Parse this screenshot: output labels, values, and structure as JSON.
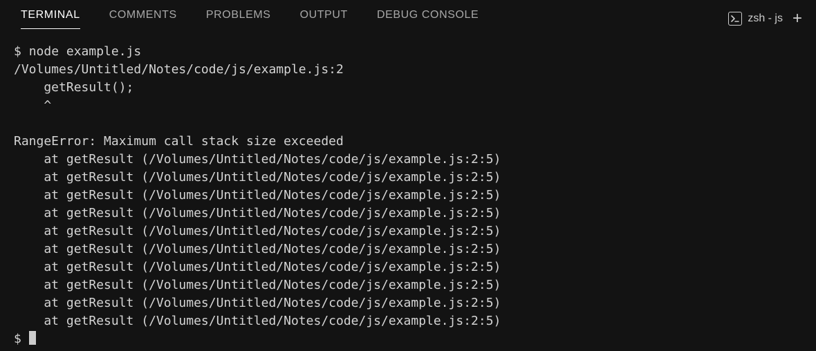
{
  "tabs": [
    {
      "label": "TERMINAL",
      "active": true
    },
    {
      "label": "COMMENTS",
      "active": false
    },
    {
      "label": "PROBLEMS",
      "active": false
    },
    {
      "label": "OUTPUT",
      "active": false
    },
    {
      "label": "DEBUG CONSOLE",
      "active": false
    }
  ],
  "shell": {
    "label": "zsh - js"
  },
  "terminal": {
    "prompt": "$",
    "command": "node example.js",
    "error_file_line": "/Volumes/Untitled/Notes/code/js/example.js:2",
    "error_code_line": "    getResult();",
    "error_caret_line": "    ^",
    "blank": "",
    "error_message": "RangeError: Maximum call stack size exceeded",
    "stack": [
      "    at getResult (/Volumes/Untitled/Notes/code/js/example.js:2:5)",
      "    at getResult (/Volumes/Untitled/Notes/code/js/example.js:2:5)",
      "    at getResult (/Volumes/Untitled/Notes/code/js/example.js:2:5)",
      "    at getResult (/Volumes/Untitled/Notes/code/js/example.js:2:5)",
      "    at getResult (/Volumes/Untitled/Notes/code/js/example.js:2:5)",
      "    at getResult (/Volumes/Untitled/Notes/code/js/example.js:2:5)",
      "    at getResult (/Volumes/Untitled/Notes/code/js/example.js:2:5)",
      "    at getResult (/Volumes/Untitled/Notes/code/js/example.js:2:5)",
      "    at getResult (/Volumes/Untitled/Notes/code/js/example.js:2:5)",
      "    at getResult (/Volumes/Untitled/Notes/code/js/example.js:2:5)"
    ]
  }
}
